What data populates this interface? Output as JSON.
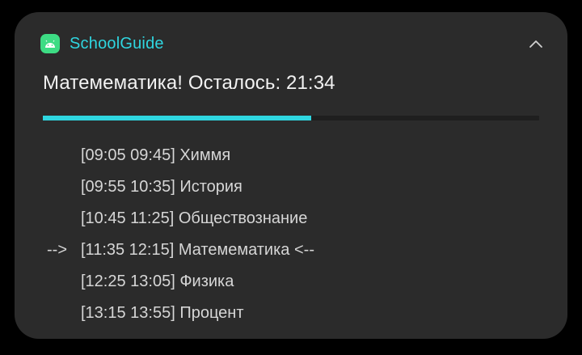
{
  "notification": {
    "app_name": "SchoolGuide",
    "title": "Матемематика! Осталось: 21:34",
    "progress": 0.54,
    "schedule": [
      {
        "marker": "",
        "text": "[09:05 09:45] Химмя"
      },
      {
        "marker": "",
        "text": "[09:55 10:35] История"
      },
      {
        "marker": "",
        "text": "[10:45 11:25] Обществознание"
      },
      {
        "marker": "-->",
        "text": "[11:35 12:15] Матемематика <--"
      },
      {
        "marker": "",
        "text": "[12:25 13:05] Физика"
      },
      {
        "marker": "",
        "text": "[13:15 13:55] Процент"
      }
    ]
  },
  "colors": {
    "accent": "#2fd6e0",
    "card_bg": "#2b2b2b",
    "app_icon": "#3ddc84"
  },
  "icons": {
    "app_icon": "android-icon",
    "collapse": "chevron-up-icon"
  }
}
